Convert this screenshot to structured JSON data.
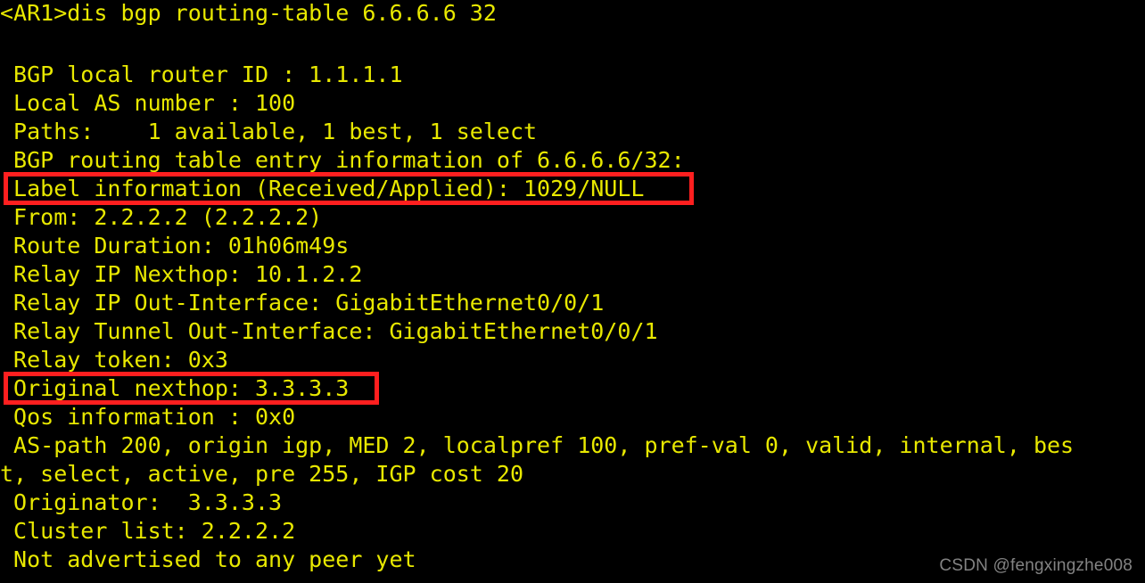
{
  "terminal": {
    "background_color": "#000000",
    "text_color": "#e8e800",
    "highlight_color": "#ff1f1f",
    "prompt_line": "<AR1>dis bgp routing-table 6.6.6.6 32",
    "blank_line": "",
    "lines": [
      " BGP local router ID : 1.1.1.1",
      " Local AS number : 100",
      " Paths:    1 available, 1 best, 1 select",
      " BGP routing table entry information of 6.6.6.6/32:",
      " Label information (Received/Applied): 1029/NULL",
      " From: 2.2.2.2 (2.2.2.2)",
      " Route Duration: 01h06m49s",
      " Relay IP Nexthop: 10.1.2.2",
      " Relay IP Out-Interface: GigabitEthernet0/0/1",
      " Relay Tunnel Out-Interface: GigabitEthernet0/0/1",
      " Relay token: 0x3",
      " Original nexthop: 3.3.3.3",
      " Qos information : 0x0",
      " AS-path 200, origin igp, MED 2, localpref 100, pref-val 0, valid, internal, bes",
      "t, select, active, pre 255, IGP cost 20",
      " Originator:  3.3.3.3",
      " Cluster list: 2.2.2.2",
      " Not advertised to any peer yet"
    ]
  },
  "highlights": {
    "label_information": "Label information (Received/Applied): 1029/NULL",
    "original_nexthop": "Original nexthop: 3.3.3.3"
  },
  "watermark": {
    "text": "CSDN @fengxingzhe008"
  }
}
